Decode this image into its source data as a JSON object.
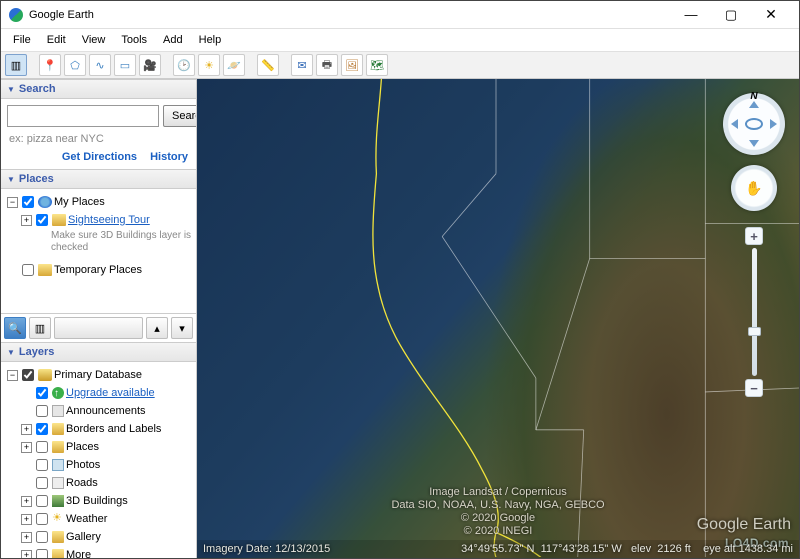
{
  "window": {
    "title": "Google Earth"
  },
  "menu": [
    "File",
    "Edit",
    "View",
    "Tools",
    "Add",
    "Help"
  ],
  "toolbar_icons": [
    "panel",
    "placemark",
    "polygon",
    "path",
    "image-overlay",
    "ruler",
    "tour",
    "sun",
    "planet",
    "clock",
    "show-panel",
    "email",
    "print",
    "save-image",
    "kml"
  ],
  "sidebar": {
    "search": {
      "title": "Search",
      "value": "",
      "placeholder": "",
      "button": "Search",
      "hint": "ex: pizza near NYC",
      "links": [
        "Get Directions",
        "History"
      ]
    },
    "places": {
      "title": "Places",
      "items": {
        "my_places": "My Places",
        "sightseeing": "Sightseeing Tour",
        "sightseeing_hint": "Make sure 3D Buildings layer is checked",
        "temporary": "Temporary Places"
      }
    },
    "layers": {
      "title": "Layers",
      "root": "Primary Database",
      "items": {
        "upgrade": "Upgrade available",
        "announce": "Announcements",
        "borders": "Borders and Labels",
        "places": "Places",
        "photos": "Photos",
        "roads": "Roads",
        "buildings": "3D Buildings",
        "weather": "Weather",
        "gallery": "Gallery",
        "more": "More"
      }
    }
  },
  "attribution": {
    "l1": "Image Landsat / Copernicus",
    "l2": "Data SIO, NOAA, U.S. Navy, NGA, GEBCO",
    "l3": "© 2020 Google",
    "l4": "© 2020 INEGI"
  },
  "status": {
    "imagery": "Imagery Date: 12/13/2015",
    "lat": "34°49'55.73\" N",
    "lon": "117°43'28.15\" W",
    "elev": "elev  2126 ft",
    "eyealt": "eye alt 1438.34 mi"
  },
  "branding": {
    "ge": "Google Earth",
    "site": "LO4D.com"
  }
}
